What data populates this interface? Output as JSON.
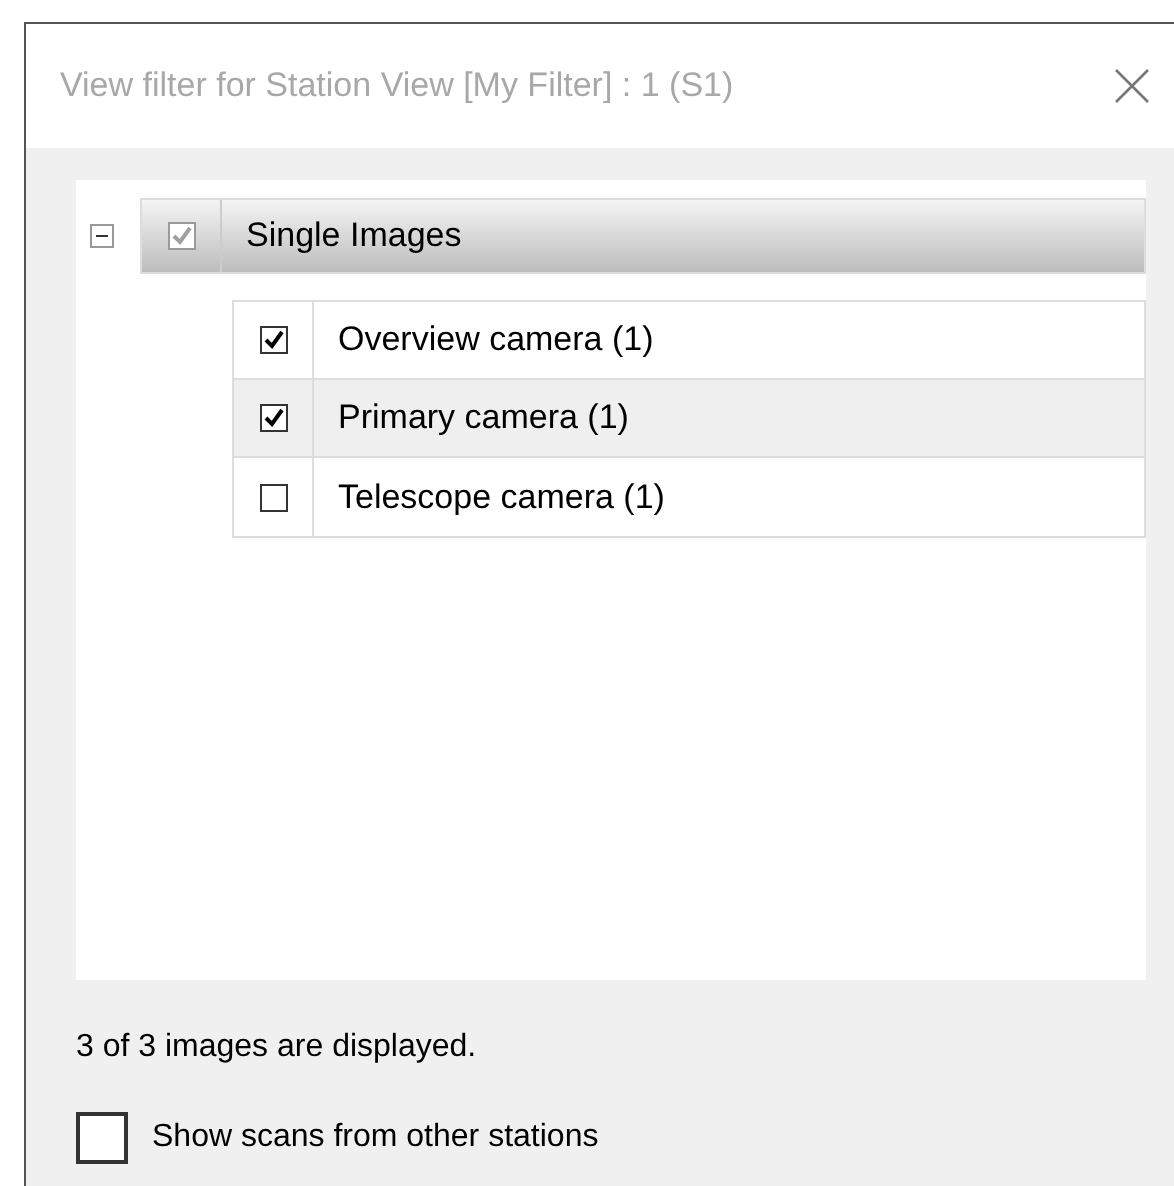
{
  "window": {
    "title": "View filter for Station View [My Filter] : 1 (S1)"
  },
  "tree": {
    "groups": [
      {
        "label": "Single Images",
        "checked": true,
        "expanded": true,
        "children": [
          {
            "label": "Overview camera (1)",
            "checked": true,
            "selected": false
          },
          {
            "label": "Primary camera (1)",
            "checked": true,
            "selected": true
          },
          {
            "label": "Telescope camera (1)",
            "checked": false,
            "selected": false
          }
        ]
      }
    ]
  },
  "status": "3 of 3 images are displayed.",
  "show_other_stations": {
    "label": "Show scans from other stations",
    "checked": false
  }
}
